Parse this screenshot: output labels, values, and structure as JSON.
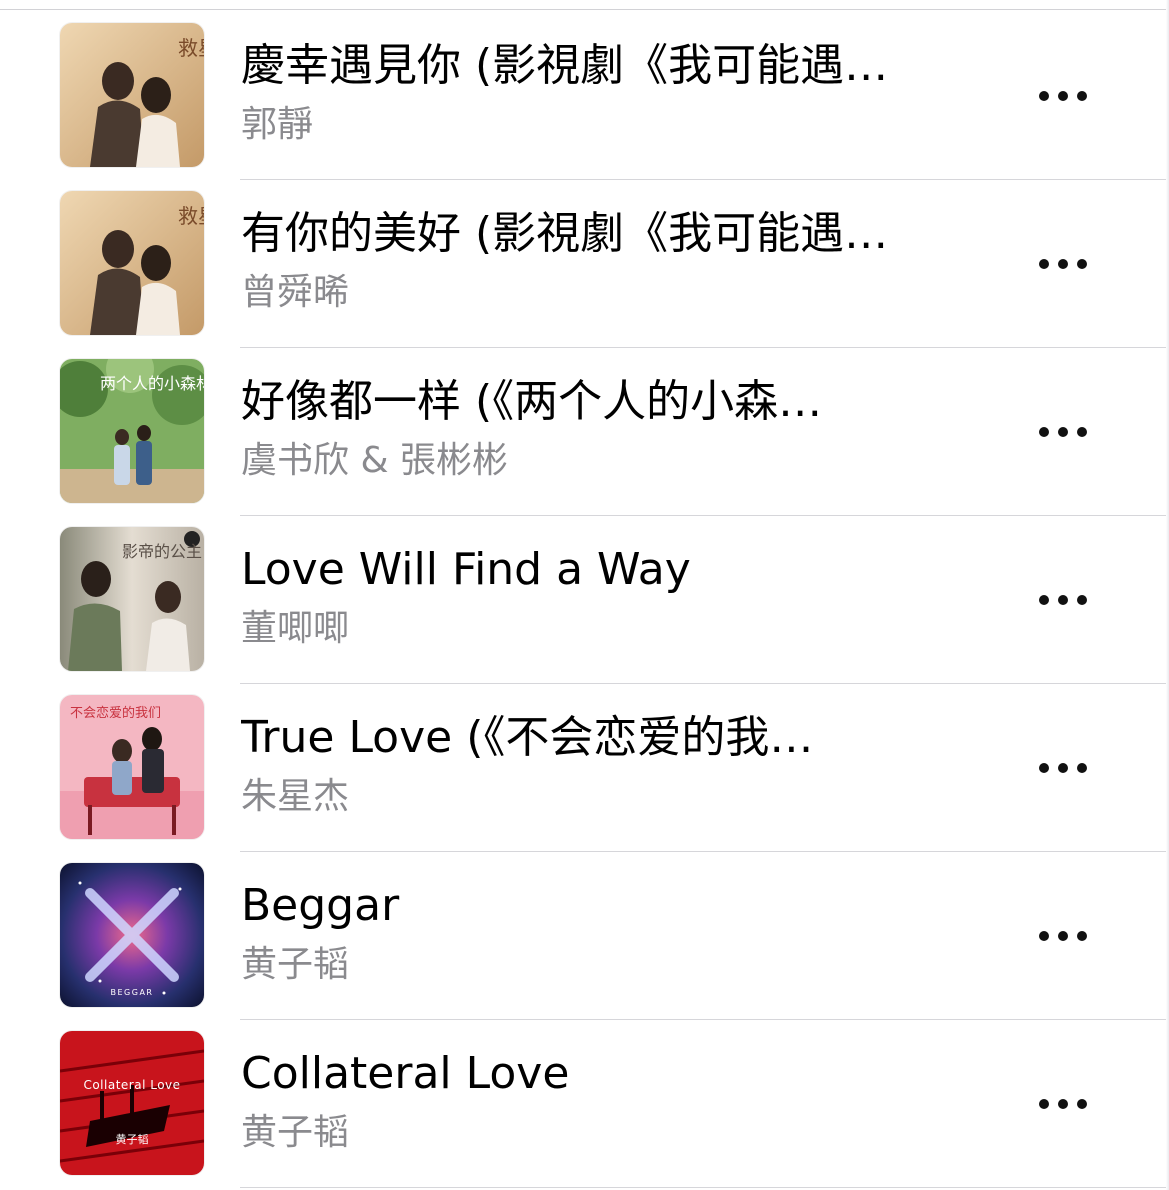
{
  "songs": [
    {
      "title": "慶幸遇見你 (影視劇《我可能遇…",
      "artist": "郭靜",
      "artwork": {
        "caption": "救星",
        "palette": [
          "#d9b98c",
          "#c39a6a",
          "#f1dcbc"
        ]
      }
    },
    {
      "title": "有你的美好 (影視劇《我可能遇…",
      "artist": "曾舜晞",
      "artwork": {
        "caption": "救星",
        "palette": [
          "#d9b98c",
          "#c39a6a",
          "#f1dcbc"
        ]
      }
    },
    {
      "title": "好像都一样 (《两个人的小森…",
      "artist": "虞书欣 & 張彬彬",
      "artwork": {
        "caption": "两个人的小森林",
        "palette": [
          "#5f8f4a",
          "#9bc27a",
          "#d7e6c4"
        ]
      }
    },
    {
      "title": "Love Will Find a Way",
      "artist": "董唧唧",
      "artwork": {
        "caption": "影帝的公主",
        "palette": [
          "#cfc7bd",
          "#a59c90",
          "#ece6de"
        ]
      }
    },
    {
      "title": "True Love (《不会恋爱的我…",
      "artist": "朱星杰",
      "artwork": {
        "caption": "不会恋爱的我们",
        "palette": [
          "#f2a9b7",
          "#e4889a",
          "#fbd6dd"
        ]
      }
    },
    {
      "title": "Beggar",
      "artist": "黄子韬",
      "artwork": {
        "caption": "BEGGAR",
        "palette": [
          "#1b2a5c",
          "#7b3aa8",
          "#e6507a"
        ]
      }
    },
    {
      "title": "Collateral Love",
      "artist": "黄子韬",
      "artwork": {
        "caption": "Collateral Love",
        "subcaption": "黄子韬",
        "palette": [
          "#b0121a",
          "#d81e25",
          "#1a0000"
        ]
      }
    }
  ],
  "more_icon": "ellipsis-icon"
}
